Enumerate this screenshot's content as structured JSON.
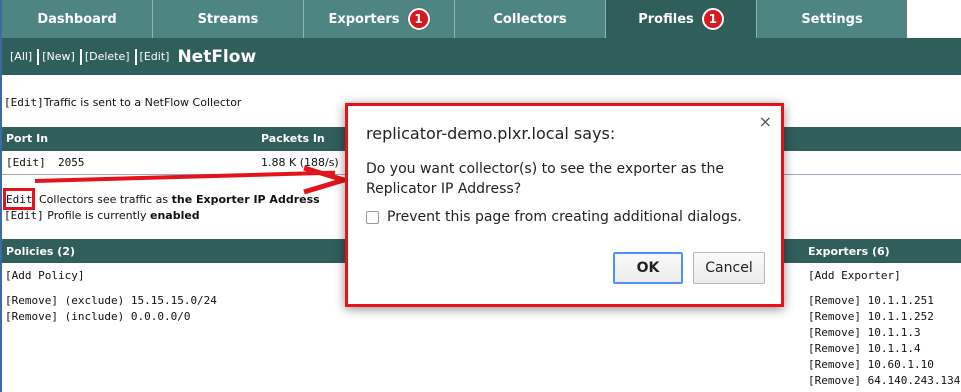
{
  "tabs": [
    {
      "label": "Dashboard",
      "badge": ""
    },
    {
      "label": "Streams",
      "badge": ""
    },
    {
      "label": "Exporters",
      "badge": "1"
    },
    {
      "label": "Collectors",
      "badge": ""
    },
    {
      "label": "Profiles",
      "badge": "1"
    },
    {
      "label": "Settings",
      "badge": ""
    }
  ],
  "subbar": {
    "links": [
      "[All]",
      "[New]",
      "[Delete]",
      "[Edit]"
    ],
    "title": "NetFlow"
  },
  "profile": {
    "traffic_edit": "[Edit]",
    "traffic_text": "Traffic is sent to a NetFlow Collector",
    "table_headers": [
      "Port In",
      "Packets In"
    ],
    "row": {
      "edit": "[Edit]",
      "port": "2055",
      "packets": "1.88 K (188/s)"
    },
    "ip_edit": "Edit",
    "ip_text_prefix": "Collectors see traffic as",
    "ip_text_value": "the Exporter IP Address",
    "enabled_edit": "[Edit]",
    "enabled_prefix": "Profile is currently",
    "enabled_value": "enabled"
  },
  "policies": {
    "header": "Policies (2)",
    "add": "[Add Policy]",
    "items": [
      {
        "remove": "[Remove]",
        "text": "(exclude) 15.15.15.0/24"
      },
      {
        "remove": "[Remove]",
        "text": "(include) 0.0.0.0/0"
      }
    ]
  },
  "exporters": {
    "header": "Exporters (6)",
    "add": "[Add Exporter]",
    "items": [
      {
        "remove": "[Remove]",
        "ip": "10.1.1.251"
      },
      {
        "remove": "[Remove]",
        "ip": "10.1.1.252"
      },
      {
        "remove": "[Remove]",
        "ip": "10.1.1.3"
      },
      {
        "remove": "[Remove]",
        "ip": "10.1.1.4"
      },
      {
        "remove": "[Remove]",
        "ip": "10.60.1.10"
      },
      {
        "remove": "[Remove]",
        "ip": "64.140.243.134"
      }
    ]
  },
  "dialog": {
    "title": "replicator-demo.plxr.local says:",
    "message": "Do you want collector(s) to see the exporter as the Replicator IP Address?",
    "checkbox_label": "Prevent this page from creating additional dialogs.",
    "ok": "OK",
    "cancel": "Cancel",
    "close": "×"
  },
  "colors": {
    "tab_bg": "#4e8582",
    "tab_active_bg": "#2f5e5b",
    "badge": "#d8181f",
    "highlight": "#e3131b"
  }
}
